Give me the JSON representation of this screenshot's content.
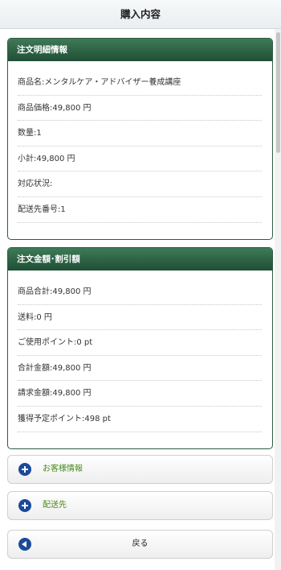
{
  "header": {
    "title": "購入内容"
  },
  "order_detail": {
    "title": "注文明細情報",
    "rows": [
      "商品名:メンタルケア・アドバイザー養成講座",
      "商品価格:49,800 円",
      "数量:1",
      "小計:49,800 円",
      "対応状況:",
      "配送先番号:1"
    ]
  },
  "amounts": {
    "title": "注文金額･割引額",
    "rows": [
      "商品合計:49,800 円",
      "送料:0 円",
      "ご使用ポイント:0 pt",
      "合計金額:49,800 円",
      "請求金額:49,800 円",
      "獲得予定ポイント:498 pt"
    ]
  },
  "buttons": {
    "customer_info": "お客様情報",
    "delivery": "配送先",
    "back": "戻る"
  },
  "colors": {
    "panel_header": "#2d6145",
    "icon_blue": "#1a4a9a",
    "link_green": "#4a8a1a"
  }
}
